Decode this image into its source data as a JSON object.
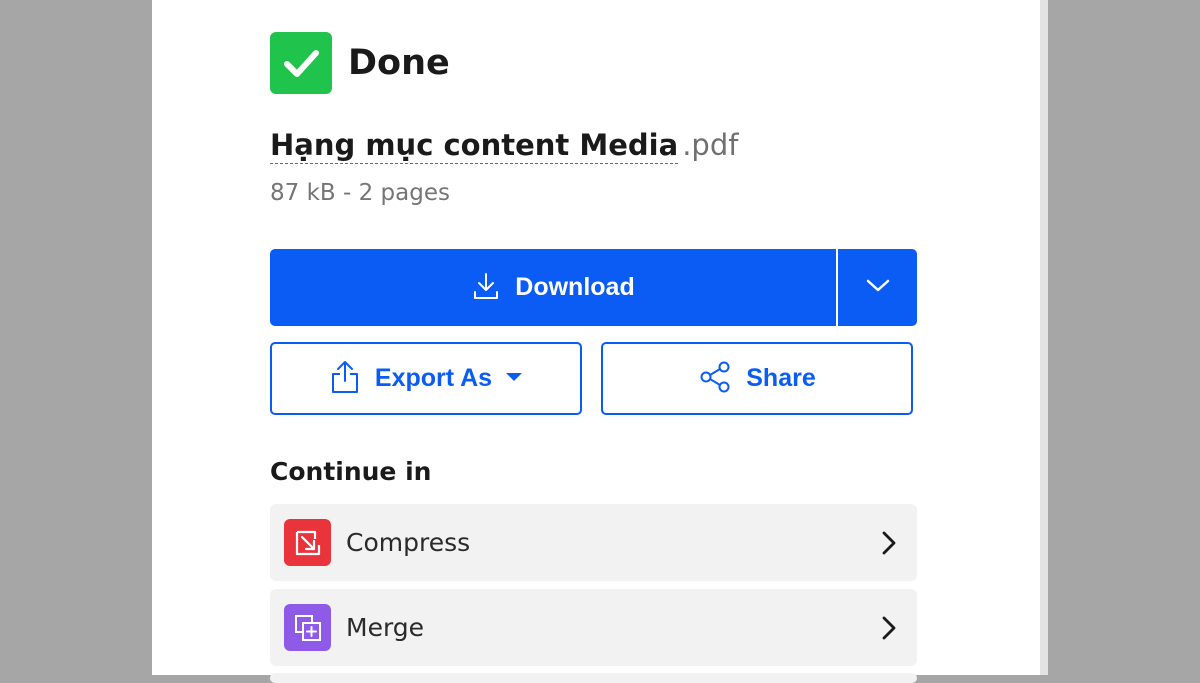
{
  "status": {
    "title": "Done",
    "icon": "check-icon",
    "color": "#20c34b"
  },
  "file": {
    "name": "Hạng mục content Media",
    "extension": ".pdf",
    "meta": "87 kB - 2 pages"
  },
  "actions": {
    "download_label": "Download",
    "export_label": "Export As",
    "share_label": "Share",
    "accent": "#0a5cf5"
  },
  "continue": {
    "title": "Continue in",
    "tools": [
      {
        "label": "Compress",
        "icon": "compress-icon",
        "color": "#e8343a"
      },
      {
        "label": "Merge",
        "icon": "merge-icon",
        "color": "#8e5ae8"
      }
    ]
  }
}
